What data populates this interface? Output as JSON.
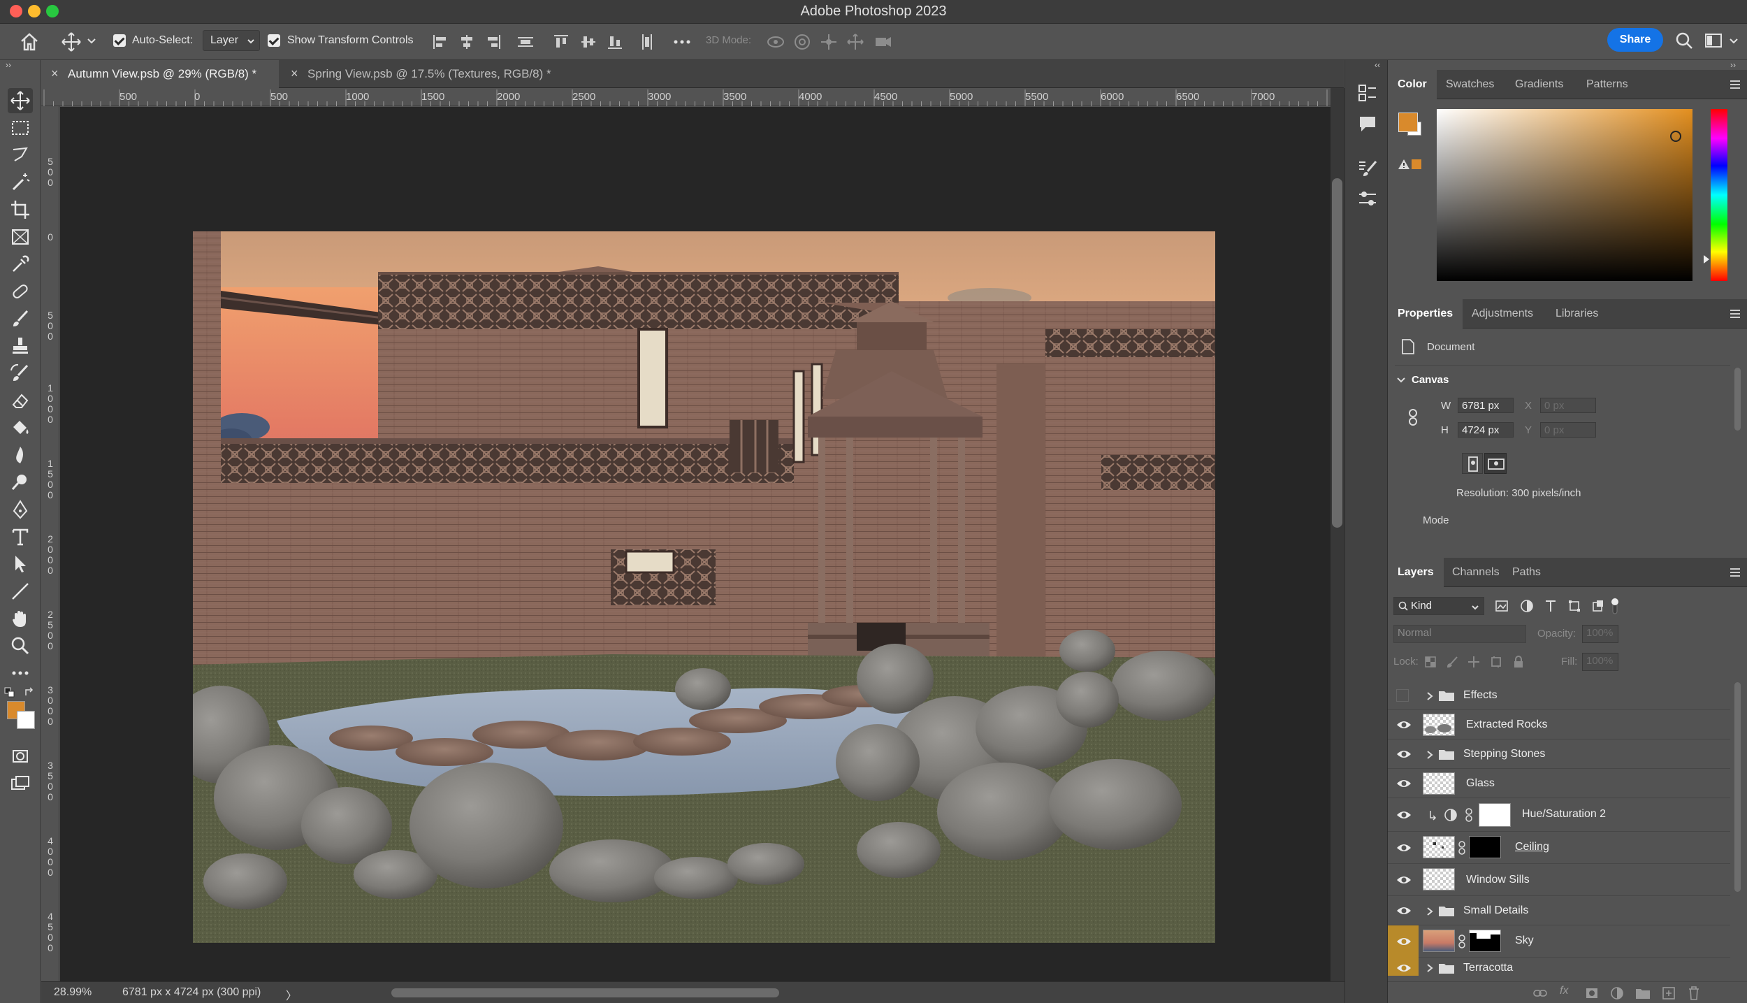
{
  "app": {
    "title": "Adobe Photoshop 2023"
  },
  "options": {
    "auto_select_label": "Auto-Select:",
    "auto_select_value": "Layer",
    "show_transform_label": "Show Transform Controls",
    "mode_3d_label": "3D Mode:",
    "share_label": "Share"
  },
  "tabs": [
    {
      "label": "Autumn View.psb @ 29% (RGB/8) *",
      "active": true
    },
    {
      "label": "Spring View.psb @ 17.5% (Textures, RGB/8) *",
      "active": false
    }
  ],
  "rulers": {
    "h": [
      "500",
      "0",
      "500",
      "1000",
      "1500",
      "2000",
      "2500",
      "3000",
      "3500",
      "4000",
      "4500",
      "5000",
      "5500",
      "6000",
      "6500",
      "7000"
    ],
    "v": [
      "500",
      "0",
      "500",
      "1000",
      "1500",
      "2000",
      "2500",
      "3000",
      "3500",
      "4000",
      "4500"
    ]
  },
  "status": {
    "zoom": "28.99%",
    "doc_info": "6781 px x 4724 px (300 ppi)",
    "arrow": "〉"
  },
  "color_panel": {
    "tabs": [
      "Color",
      "Swatches",
      "Gradients",
      "Patterns"
    ],
    "foreground": "#d98a2c",
    "background": "#ffffff"
  },
  "properties_panel": {
    "tabs": [
      "Properties",
      "Adjustments",
      "Libraries"
    ],
    "doc_label": "Document",
    "canvas_label": "Canvas",
    "w_label": "W",
    "w_value": "6781 px",
    "h_label": "H",
    "h_value": "4724 px",
    "x_label": "X",
    "x_placeholder": "0 px",
    "y_label": "Y",
    "y_placeholder": "0 px",
    "resolution": "Resolution: 300 pixels/inch",
    "mode_label": "Mode"
  },
  "layers_panel": {
    "tabs": [
      "Layers",
      "Channels",
      "Paths"
    ],
    "filter_kind": "Kind",
    "blend_mode": "Normal",
    "opacity_label": "Opacity:",
    "opacity_value": "100%",
    "lock_label": "Lock:",
    "fill_label": "Fill:",
    "fill_value": "100%",
    "layers": [
      {
        "name": "Effects",
        "kind": "group",
        "visible": false
      },
      {
        "name": "Extracted Rocks",
        "kind": "layer",
        "visible": true
      },
      {
        "name": "Stepping Stones",
        "kind": "group",
        "visible": true
      },
      {
        "name": "Glass",
        "kind": "layer",
        "visible": true
      },
      {
        "name": "Hue/Saturation 2",
        "kind": "adjustment",
        "visible": true
      },
      {
        "name": "Ceiling",
        "kind": "masked",
        "visible": true
      },
      {
        "name": "Window Sills",
        "kind": "layer",
        "visible": true
      },
      {
        "name": "Small Details",
        "kind": "group",
        "visible": true
      },
      {
        "name": "Sky",
        "kind": "masked-sky",
        "visible": true,
        "highlight": true
      },
      {
        "name": "Terracotta",
        "kind": "group",
        "visible": true,
        "highlight": true
      }
    ]
  }
}
